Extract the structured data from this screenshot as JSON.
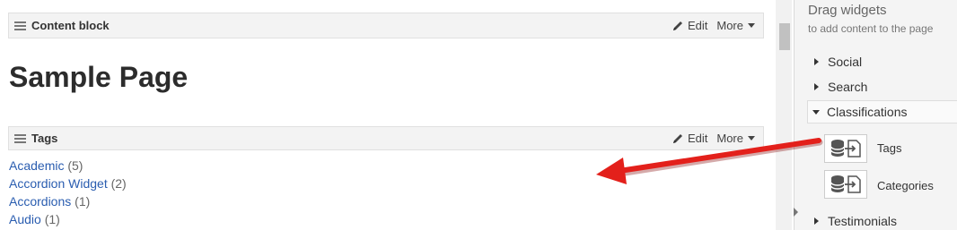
{
  "main": {
    "content_block": {
      "title": "Content block",
      "edit_label": "Edit",
      "more_label": "More"
    },
    "page_heading": "Sample Page",
    "tags_block": {
      "title": "Tags",
      "edit_label": "Edit",
      "more_label": "More"
    },
    "tags": [
      {
        "name": "Academic",
        "count": "(5)"
      },
      {
        "name": "Accordion Widget",
        "count": "(2)"
      },
      {
        "name": "Accordions",
        "count": "(1)"
      },
      {
        "name": "Audio",
        "count": "(1)"
      }
    ]
  },
  "sidebar": {
    "title": "Drag widgets",
    "subtitle": "to add content to the page",
    "groups": [
      {
        "label": "Social"
      },
      {
        "label": "Search"
      },
      {
        "label": "Classifications"
      },
      {
        "label": "Testimonials"
      }
    ],
    "widgets": [
      {
        "label": "Tags",
        "icon": "database-import-icon"
      },
      {
        "label": "Categories",
        "icon": "database-import-icon"
      }
    ]
  },
  "colors": {
    "link": "#2a5db0",
    "arrow": "#e3201b"
  }
}
